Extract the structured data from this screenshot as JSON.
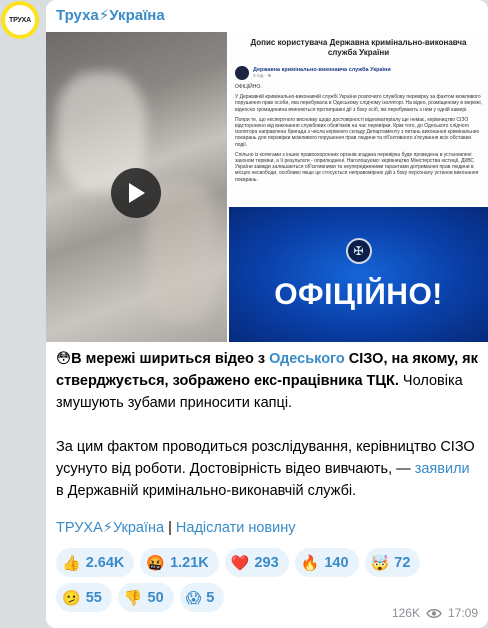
{
  "avatar": {
    "text": "ТРУХА"
  },
  "channel": {
    "name": "Труха⚡Україна"
  },
  "media": {
    "doc": {
      "title": "Допис користувача Державна кримінально-виконавча служба України",
      "org": "Державна кримінально-виконавча служба України",
      "time": "3 год · ⊕",
      "heading": "ОФІЦІЙНО.",
      "p1": "У Державній кримінально-виконавчій службі України розпочато службову перевірку за фактом можливого порушення прав особи, яка перебувала в Одеському слідчому ізоляторі. На відео, розміщеному в мережі, відносно громадянина вчиняються протиправні дії з боку осіб, які перебувають з ним у одній камері.",
      "p2": "Попри те, що експертного висновку щодо достовірності відеоматеріалу ще немає, керівництво СІЗО відсторонено від виконання службових обов'язків на час перевірки. Крім того, до Одеського слідчого ізолятора направлена бригада з числа керівного складу Департаменту з питань виконання кримінальних покарань для перевірки можливого порушення прав людини та об'єктивного з'ясування всіх обставин події.",
      "p3": "Спільно із колегами з інших правоохоронних органів згадана перевірка буде проведена в установлені законом терміни, а її результати - оприлюднені. Наголошуємо: керівництво Міністерства юстиції, ДКВС України завжди залишаються об'єктивними та неупередженими гарантами дотримання прав людини в місцях несвободи, особливо якщо це стосується неправомірних дій з боку персоналу установ виконання покарань."
    },
    "official_banner": {
      "text": "ОФІЦІЙНО!"
    }
  },
  "post": {
    "p1_emoji": "😳",
    "p1_a": "В мережі шириться відео з ",
    "p1_link": "Одеського",
    "p1_b": " СІЗО, на якому, як стверджується, зображено екс-працівника ТЦК.",
    "p1_c": " Чоловіка змушують зубами приносити капці.",
    "p2_a": "За цим фактом проводиться розслідування, керівництво СІЗО усунуто від роботи. Достовірність відео вивчають, — ",
    "p2_link": "заявили",
    "p2_b": " в Державній кримінально-виконавчій службі."
  },
  "footer": {
    "channel_link": "ТРУХА⚡Україна",
    "separator": " | ",
    "submit_link": "Надіслати новину"
  },
  "reactions": [
    {
      "emoji": "👍",
      "count": "2.64K"
    },
    {
      "emoji": "🤬",
      "count": "1.21K"
    },
    {
      "emoji": "❤️",
      "count": "293"
    },
    {
      "emoji": "🔥",
      "count": "140"
    },
    {
      "emoji": "🤯",
      "count": "72"
    },
    {
      "emoji": "🫤",
      "count": "55"
    },
    {
      "emoji": "👎",
      "count": "50"
    },
    {
      "emoji": "😱",
      "count": "5"
    }
  ],
  "meta": {
    "views": "126K",
    "time": "17:09"
  },
  "colors": {
    "accent": "#3a8bc8",
    "avatar_bg": "#ffe11a",
    "banner": "#0a3fa8"
  }
}
